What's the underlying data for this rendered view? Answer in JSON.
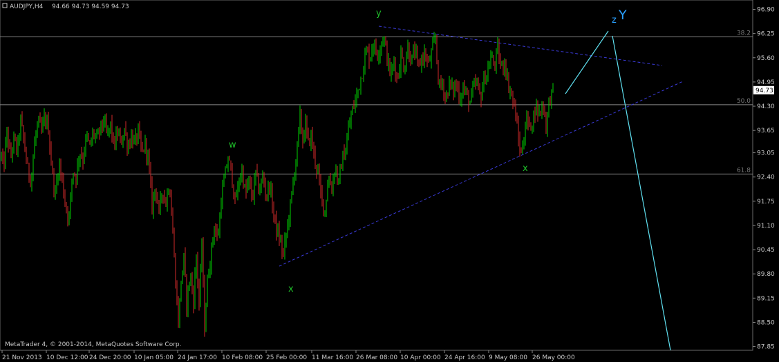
{
  "header": {
    "symbol": "AUDJPY,H4",
    "ohlc": "94.66 94.73 94.59 94.73"
  },
  "footer": {
    "copyright": "MetaTrader 4, © 2001-2014, MetaQuotes Software Corp."
  },
  "colors": {
    "background": "#000000",
    "candle_up": "#00d200",
    "candle_down": "#d22a2a",
    "grid_line": "#8a8a8a",
    "trendline": "#3a3ad8",
    "projection": "#5fe0f0",
    "wave_label": "#1fbf2a",
    "Y_label": "#2aa0ff"
  },
  "price_axis": {
    "ticks": [
      "96.90",
      "96.25",
      "95.60",
      "94.95",
      "94.30",
      "93.65",
      "93.05",
      "92.40",
      "91.75",
      "91.10",
      "90.45",
      "89.80",
      "89.15",
      "88.50",
      "87.85"
    ],
    "current_price": "94.73"
  },
  "time_axis": {
    "ticks": [
      "21 Nov 2013",
      "10 Dec 12:00",
      "24 Dec 20:00",
      "10 Jan 05:00",
      "24 Jan 17:00",
      "10 Feb 08:00",
      "25 Feb 00:00",
      "11 Mar 16:00",
      "26 Mar 08:00",
      "10 Apr 00:00",
      "24 Apr 16:00",
      "9 May 08:00",
      "26 May 00:00"
    ]
  },
  "fib_levels": [
    {
      "label": "38.2",
      "price": 96.16
    },
    {
      "label": "50.0",
      "price": 94.34
    },
    {
      "label": "61.8",
      "price": 92.48
    }
  ],
  "wave_labels": {
    "w": "w",
    "x1": "x",
    "y": "y",
    "x2": "x",
    "z": "z",
    "Y": "Y"
  },
  "chart_data": {
    "type": "candlestick",
    "symbol": "AUDJPY",
    "timeframe": "H4",
    "ylim": [
      87.75,
      97.15
    ],
    "path": [
      [
        0,
        93.2
      ],
      [
        5,
        92.6
      ],
      [
        10,
        93.6
      ],
      [
        15,
        92.9
      ],
      [
        20,
        93.4
      ],
      [
        25,
        93.1
      ],
      [
        30,
        93.9
      ],
      [
        35,
        93.3
      ],
      [
        40,
        92.6
      ],
      [
        45,
        92.3
      ],
      [
        50,
        93.3
      ],
      [
        55,
        93.9
      ],
      [
        60,
        93.6
      ],
      [
        65,
        94.0
      ],
      [
        70,
        93.7
      ],
      [
        75,
        92.6
      ],
      [
        80,
        91.9
      ],
      [
        85,
        92.8
      ],
      [
        90,
        92.3
      ],
      [
        95,
        91.6
      ],
      [
        100,
        91.3
      ],
      [
        105,
        92.6
      ],
      [
        110,
        92.4
      ],
      [
        115,
        93.1
      ],
      [
        120,
        92.9
      ],
      [
        125,
        93.5
      ],
      [
        130,
        93.2
      ],
      [
        135,
        93.6
      ],
      [
        140,
        93.4
      ],
      [
        145,
        93.7
      ],
      [
        150,
        93.9
      ],
      [
        155,
        93.5
      ],
      [
        160,
        93.8
      ],
      [
        165,
        93.2
      ],
      [
        170,
        93.6
      ],
      [
        175,
        93.3
      ],
      [
        180,
        93.7
      ],
      [
        185,
        93.2
      ],
      [
        190,
        93.5
      ],
      [
        195,
        93.3
      ],
      [
        200,
        93.6
      ],
      [
        205,
        93.0
      ],
      [
        210,
        93.3
      ],
      [
        215,
        92.8
      ],
      [
        220,
        91.6
      ],
      [
        225,
        92.2
      ],
      [
        230,
        91.4
      ],
      [
        235,
        92.1
      ],
      [
        240,
        91.7
      ],
      [
        245,
        92.3
      ],
      [
        250,
        90.9
      ],
      [
        255,
        89.3
      ],
      [
        258,
        88.5
      ],
      [
        262,
        89.6
      ],
      [
        266,
        90.2
      ],
      [
        270,
        89.0
      ],
      [
        275,
        89.8
      ],
      [
        280,
        89.1
      ],
      [
        284,
        90.3
      ],
      [
        288,
        89.0
      ],
      [
        292,
        90.6
      ],
      [
        296,
        88.4
      ],
      [
        300,
        89.6
      ],
      [
        305,
        90.3
      ],
      [
        310,
        91.1
      ],
      [
        315,
        90.7
      ],
      [
        320,
        91.8
      ],
      [
        325,
        92.4
      ],
      [
        330,
        92.9
      ],
      [
        335,
        92.5
      ],
      [
        340,
        91.7
      ],
      [
        345,
        92.2
      ],
      [
        350,
        92.6
      ],
      [
        355,
        91.9
      ],
      [
        360,
        92.3
      ],
      [
        365,
        91.8
      ],
      [
        370,
        92.5
      ],
      [
        375,
        92.0
      ],
      [
        380,
        92.4
      ],
      [
        385,
        91.9
      ],
      [
        390,
        92.2
      ],
      [
        395,
        91.5
      ],
      [
        400,
        91.0
      ],
      [
        405,
        90.7
      ],
      [
        410,
        90.3
      ],
      [
        415,
        91.0
      ],
      [
        420,
        91.6
      ],
      [
        425,
        92.4
      ],
      [
        430,
        93.2
      ],
      [
        434,
        94.0
      ],
      [
        438,
        93.4
      ],
      [
        442,
        93.8
      ],
      [
        446,
        93.3
      ],
      [
        450,
        93.5
      ],
      [
        455,
        92.9
      ],
      [
        460,
        92.5
      ],
      [
        465,
        91.8
      ],
      [
        470,
        91.5
      ],
      [
        475,
        92.4
      ],
      [
        480,
        92.1
      ],
      [
        485,
        92.7
      ],
      [
        490,
        92.2
      ],
      [
        495,
        92.9
      ],
      [
        500,
        93.1
      ],
      [
        505,
        93.8
      ],
      [
        510,
        94.2
      ],
      [
        515,
        94.5
      ],
      [
        520,
        94.9
      ],
      [
        525,
        95.3
      ],
      [
        530,
        95.8
      ],
      [
        535,
        95.6
      ],
      [
        540,
        96.0
      ],
      [
        545,
        95.7
      ],
      [
        550,
        95.9
      ],
      [
        555,
        96.2
      ],
      [
        560,
        95.6
      ],
      [
        565,
        95.1
      ],
      [
        570,
        95.5
      ],
      [
        575,
        95.0
      ],
      [
        580,
        95.7
      ],
      [
        585,
        95.3
      ],
      [
        590,
        95.9
      ],
      [
        595,
        95.5
      ],
      [
        600,
        95.8
      ],
      [
        605,
        95.3
      ],
      [
        610,
        95.6
      ],
      [
        615,
        95.7
      ],
      [
        620,
        95.4
      ],
      [
        625,
        95.8
      ],
      [
        630,
        96.1
      ],
      [
        635,
        94.8
      ],
      [
        640,
        94.9
      ],
      [
        645,
        94.5
      ],
      [
        650,
        94.9
      ],
      [
        655,
        94.7
      ],
      [
        660,
        94.9
      ],
      [
        665,
        94.5
      ],
      [
        670,
        94.8
      ],
      [
        675,
        94.6
      ],
      [
        680,
        94.4
      ],
      [
        685,
        94.8
      ],
      [
        690,
        94.9
      ],
      [
        695,
        94.5
      ],
      [
        700,
        95.0
      ],
      [
        705,
        95.2
      ],
      [
        710,
        95.6
      ],
      [
        715,
        95.4
      ],
      [
        720,
        95.8
      ],
      [
        725,
        95.3
      ],
      [
        730,
        95.5
      ],
      [
        735,
        94.9
      ],
      [
        740,
        94.6
      ],
      [
        745,
        94.2
      ],
      [
        750,
        93.4
      ],
      [
        754,
        93.0
      ],
      [
        758,
        93.5
      ],
      [
        762,
        94.0
      ],
      [
        766,
        93.7
      ],
      [
        770,
        93.9
      ],
      [
        775,
        94.3
      ],
      [
        780,
        94.1
      ],
      [
        785,
        94.4
      ],
      [
        790,
        93.8
      ],
      [
        795,
        94.5
      ],
      [
        800,
        94.7
      ]
    ]
  }
}
